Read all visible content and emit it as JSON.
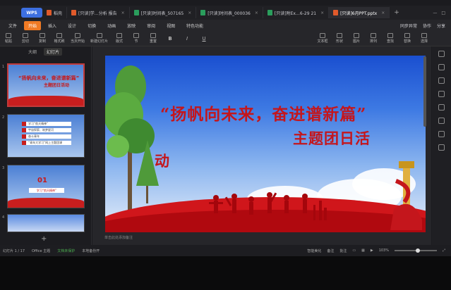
{
  "tabs": {
    "wps": "WPS",
    "items": [
      {
        "label": "稻壳",
        "color": "#e05a2b"
      },
      {
        "label": "[只读]学…分析 报告",
        "color": "#e05a2b"
      },
      {
        "label": "[只读]时间表_507165",
        "color": "#2a9d5c"
      },
      {
        "label": "[只读]时间表_000036",
        "color": "#2a9d5c"
      },
      {
        "label": "[只读]附Ex…6-29 21",
        "color": "#2a9d5c"
      },
      {
        "label": "[只读]6月PPT.pptx",
        "color": "#e05a2b"
      }
    ],
    "plus": "+"
  },
  "menu": {
    "file": "文件",
    "items": [
      "开始",
      "插入",
      "设计",
      "切换",
      "动画",
      "放映",
      "审阅",
      "视图",
      "特色功能"
    ],
    "right": [
      "同步异常",
      "协作",
      "分享"
    ]
  },
  "ribbon": [
    "粘贴",
    "剪切",
    "复制",
    "格式刷",
    "当页开始",
    "新建幻灯片",
    "版式",
    "节",
    "重置",
    "B",
    "I",
    "U",
    "文本框",
    "形状",
    "图片",
    "排列",
    "查找",
    "替换",
    "选择"
  ],
  "leftpanel": {
    "tab1": "大纲",
    "tab2": "幻灯片",
    "thumbs": [
      {
        "num": "1",
        "title": "“扬帆向未来，奋进谱新篇”",
        "title2": "主题团日活动"
      },
      {
        "num": "2",
        "items": [
          "学习“航天精神”",
          "宇宙探索、筑梦星河",
          "奋斗青年",
          "“青年大学习”网上主题团课"
        ]
      },
      {
        "num": "3",
        "big": "01",
        "sub": "学习“航天精神”"
      },
      {
        "num": "4"
      }
    ],
    "plus": "+"
  },
  "slide": {
    "title_line1": "“扬帆向未来，奋进谱新篇”",
    "title_line2": "主题团日活",
    "title_line3": "动"
  },
  "notes_placeholder": "单击此处添加备注",
  "status": {
    "page": "幻灯片 1 / 17",
    "theme": "Office 主题",
    "backup": "文档未保护",
    "local": "本地备份开",
    "beautify": "智能美化",
    "notes": "备注",
    "comments": "批注",
    "zoom": "103%"
  }
}
